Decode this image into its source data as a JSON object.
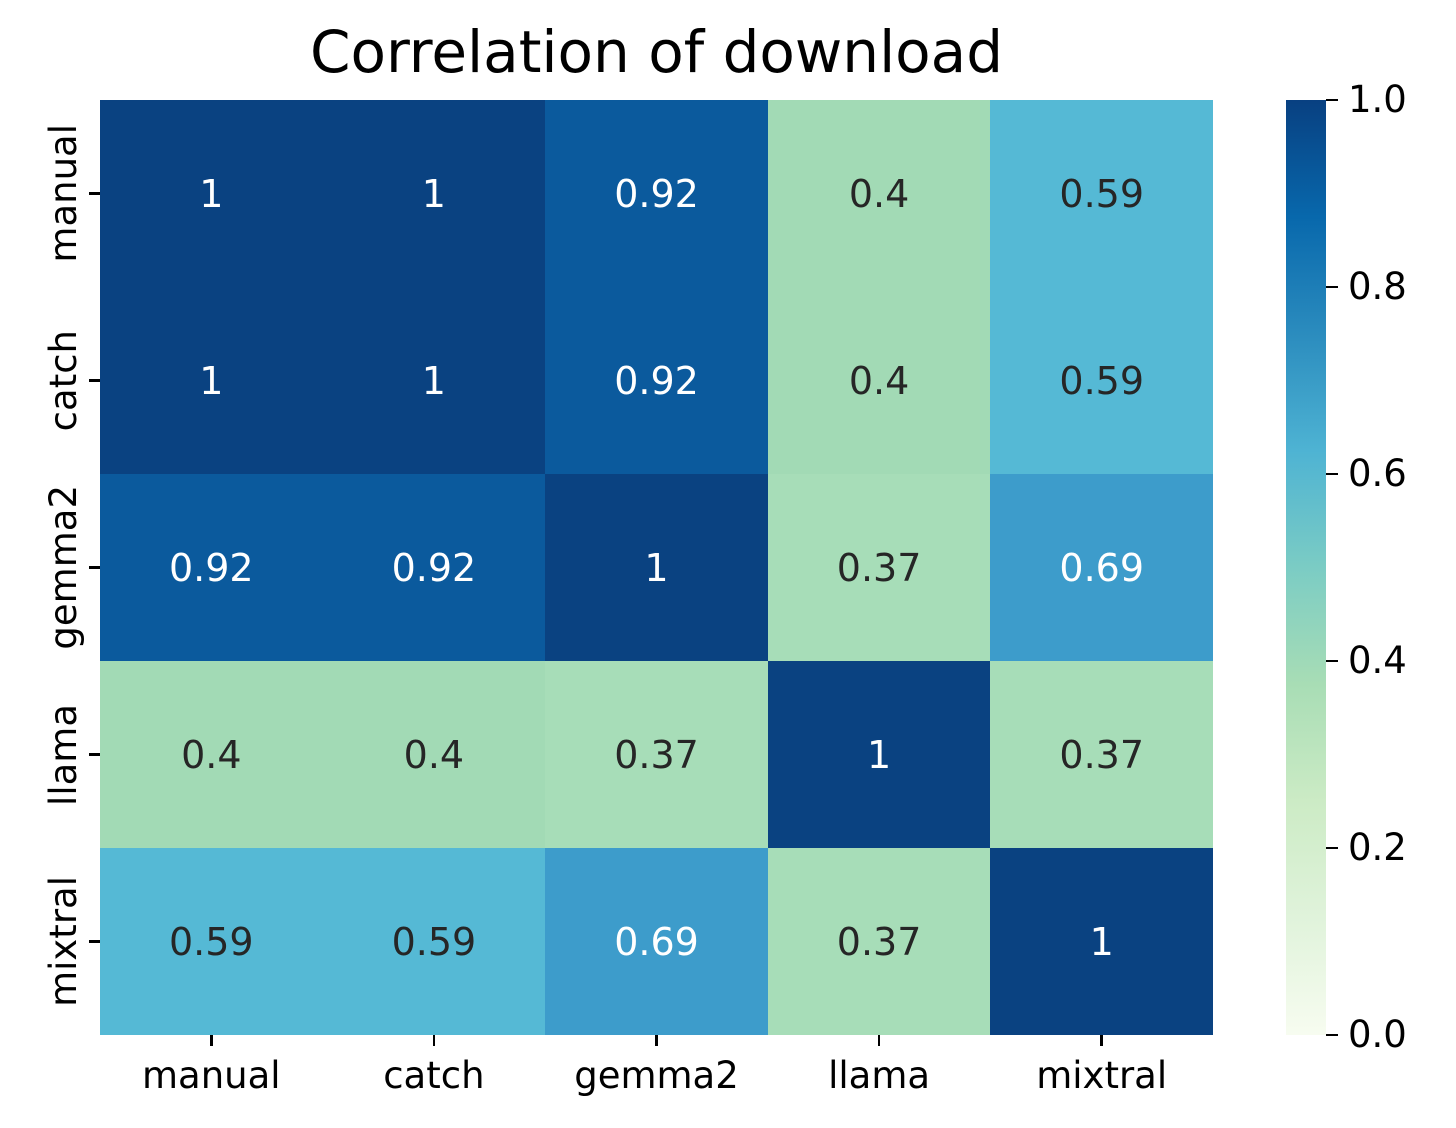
{
  "chart_data": {
    "type": "heatmap",
    "title": "Correlation of download",
    "xlabel": "",
    "ylabel": "",
    "colormap": "GnBu",
    "grid": false,
    "legend_position": "right-colorbar",
    "x_categories": [
      "manual",
      "catch",
      "gemma2",
      "llama",
      "mixtral"
    ],
    "y_categories": [
      "manual",
      "catch",
      "gemma2",
      "llama",
      "mixtral"
    ],
    "values": [
      [
        1,
        1,
        0.92,
        0.4,
        0.59
      ],
      [
        1,
        1,
        0.92,
        0.4,
        0.59
      ],
      [
        0.92,
        0.92,
        1,
        0.37,
        0.69
      ],
      [
        0.4,
        0.4,
        0.37,
        1,
        0.37
      ],
      [
        0.59,
        0.59,
        0.69,
        0.37,
        1
      ]
    ],
    "cell_labels": [
      [
        "1",
        "1",
        "0.92",
        "0.4",
        "0.59"
      ],
      [
        "1",
        "1",
        "0.92",
        "0.4",
        "0.59"
      ],
      [
        "0.92",
        "0.92",
        "1",
        "0.37",
        "0.69"
      ],
      [
        "0.4",
        "0.4",
        "0.37",
        "1",
        "0.37"
      ],
      [
        "0.59",
        "0.59",
        "0.69",
        "0.37",
        "1"
      ]
    ],
    "cell_colors": [
      [
        "#0a4281",
        "#0a4281",
        "#0b5a9d",
        "#a2dab5",
        "#55b9d5"
      ],
      [
        "#0a4281",
        "#0a4281",
        "#0b5a9d",
        "#a2dab5",
        "#55b9d5"
      ],
      [
        "#0b5a9d",
        "#0b5a9d",
        "#0a4281",
        "#a7ddb8",
        "#3d9ccb"
      ],
      [
        "#a2dab5",
        "#a2dab5",
        "#a7ddb8",
        "#0a4281",
        "#a7ddb8"
      ],
      [
        "#55b9d5",
        "#55b9d5",
        "#3d9ccb",
        "#a7ddb8",
        "#0a4281"
      ]
    ],
    "cell_text_colors": [
      [
        "#ffffff",
        "#ffffff",
        "#ffffff",
        "#262626",
        "#262626"
      ],
      [
        "#ffffff",
        "#ffffff",
        "#ffffff",
        "#262626",
        "#262626"
      ],
      [
        "#ffffff",
        "#ffffff",
        "#ffffff",
        "#262626",
        "#ffffff"
      ],
      [
        "#262626",
        "#262626",
        "#262626",
        "#ffffff",
        "#262626"
      ],
      [
        "#262626",
        "#262626",
        "#ffffff",
        "#262626",
        "#ffffff"
      ]
    ],
    "colorbar": {
      "vmin": 0.0,
      "vmax": 1.0,
      "ticks": [
        "1.0",
        "0.8",
        "0.6",
        "0.4",
        "0.2",
        "0.0"
      ],
      "tick_values": [
        1.0,
        0.8,
        0.6,
        0.4,
        0.2,
        0.0
      ],
      "gradient_stops": [
        {
          "pos": 0,
          "color": "#084081"
        },
        {
          "pos": 12.5,
          "color": "#0868ac"
        },
        {
          "pos": 25,
          "color": "#2b8cbe"
        },
        {
          "pos": 37.5,
          "color": "#4eb3d3"
        },
        {
          "pos": 50,
          "color": "#7bccc4"
        },
        {
          "pos": 62.5,
          "color": "#a8ddb5"
        },
        {
          "pos": 75,
          "color": "#ccebc5"
        },
        {
          "pos": 87.5,
          "color": "#e0f3db"
        },
        {
          "pos": 100,
          "color": "#f7fcf0"
        }
      ]
    }
  }
}
